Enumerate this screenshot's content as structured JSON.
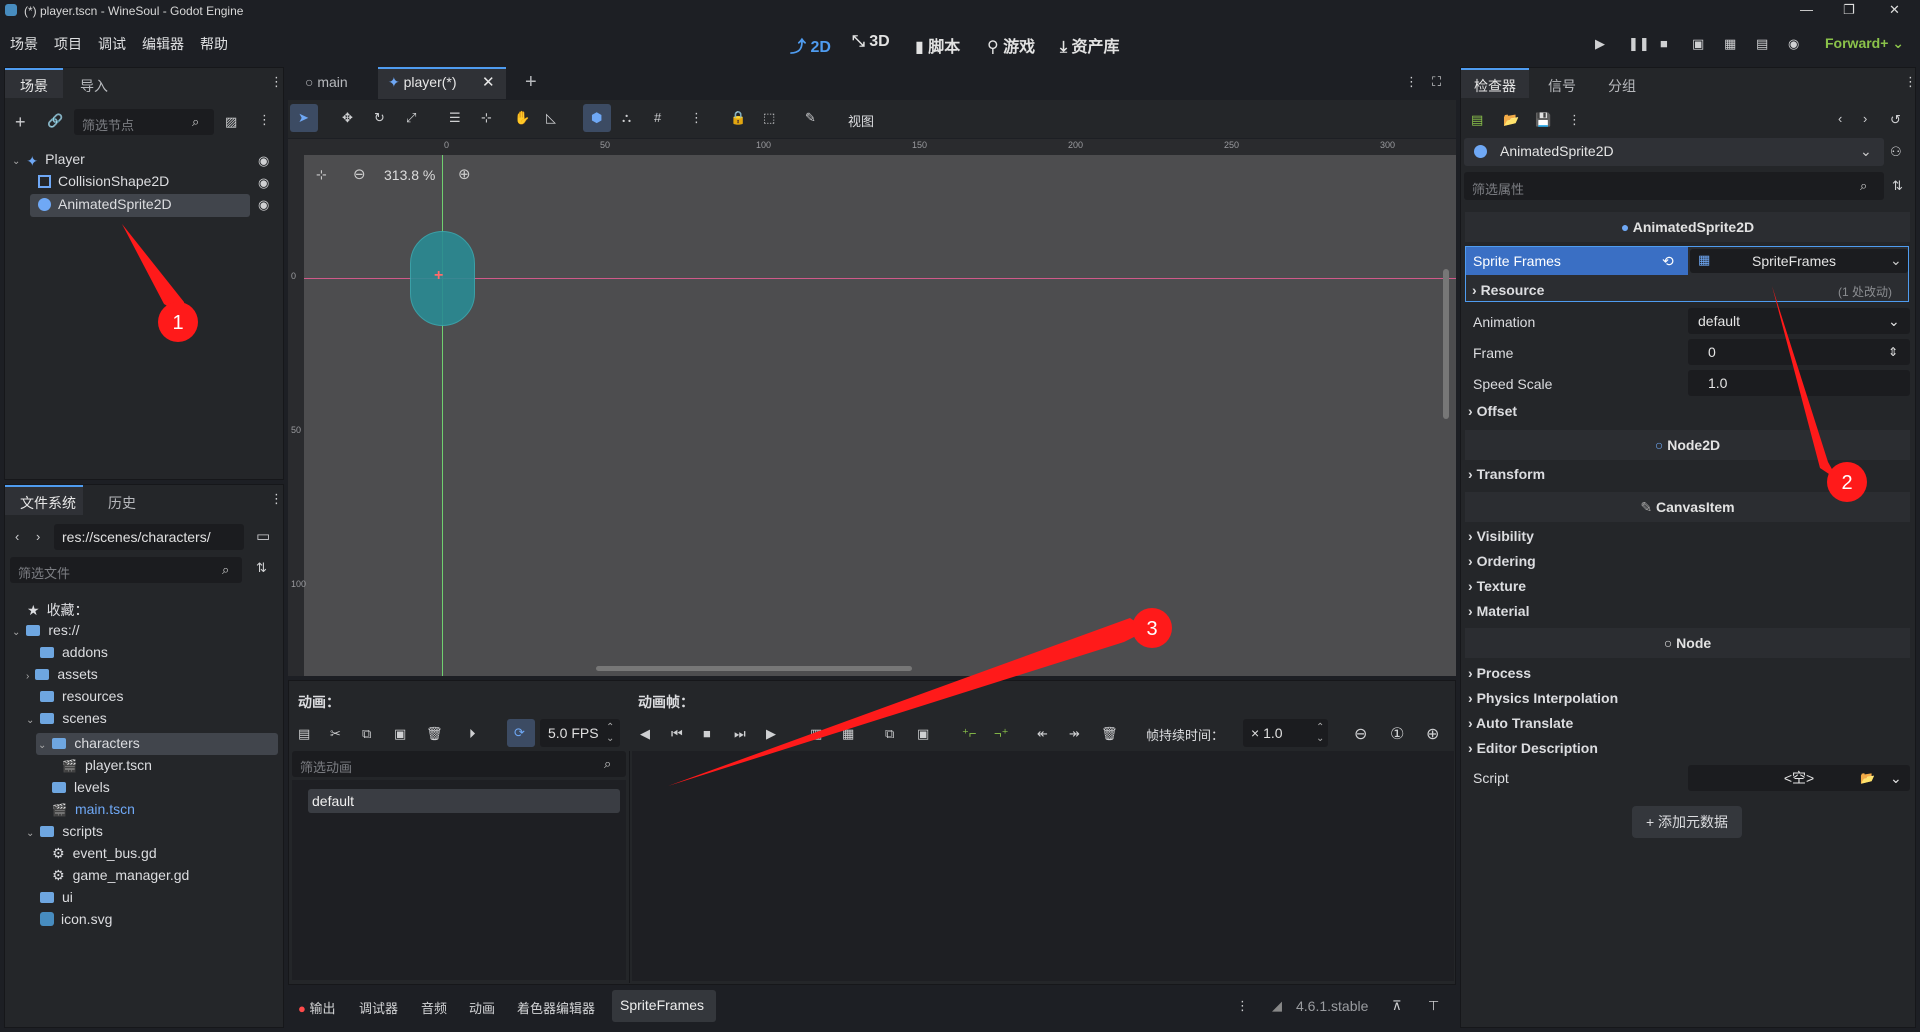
{
  "window": {
    "title": "(*) player.tscn - WineSoul - Godot Engine"
  },
  "menu": [
    "场景",
    "项目",
    "调试",
    "编辑器",
    "帮助"
  ],
  "workspaces": [
    {
      "label": "2D",
      "icon": "2d-icon"
    },
    {
      "label": "3D",
      "icon": "3d-icon"
    },
    {
      "label": "脚本",
      "icon": "script-icon"
    },
    {
      "label": "游戏",
      "icon": "game-icon"
    },
    {
      "label": "资产库",
      "icon": "assetlib-icon"
    }
  ],
  "renderer": "Forward+",
  "scene_dock": {
    "tabs": [
      "场景",
      "导入"
    ],
    "filter_placeholder": "筛选节点",
    "nodes": [
      "Player",
      "CollisionShape2D",
      "AnimatedSprite2D"
    ]
  },
  "fs_dock": {
    "tabs": [
      "文件系统",
      "历史"
    ],
    "path": "res://scenes/characters/",
    "filter_placeholder": "筛选文件",
    "favorites": "收藏：",
    "tree": [
      "res://",
      "addons",
      "assets",
      "resources",
      "scenes",
      "characters",
      "player.tscn",
      "levels",
      "main.tscn",
      "scripts",
      "event_bus.gd",
      "game_manager.gd",
      "ui",
      "icon.svg"
    ]
  },
  "editor_tabs": [
    "main",
    "player(*)"
  ],
  "toolbar": {
    "view_label": "视图"
  },
  "viewport": {
    "zoom": "313.8 %",
    "ruler_top": [
      "0",
      "50",
      "100",
      "150",
      "200",
      "250",
      "300"
    ],
    "ruler_left": [
      "0",
      "50",
      "100"
    ]
  },
  "anim_panel": {
    "anim_label": "动画：",
    "frames_label": "动画帧：",
    "fps": "5.0 FPS",
    "filter_placeholder": "筛选动画",
    "animations": [
      "default"
    ],
    "frame_duration_label": "帧持续时间：",
    "frame_duration": "× 1.0"
  },
  "bottom_tabs": [
    "输出",
    "调试器",
    "音频",
    "动画",
    "着色器编辑器",
    "SpriteFrames"
  ],
  "version": "4.6.1.stable",
  "inspector": {
    "tabs": [
      "检查器",
      "信号",
      "分组"
    ],
    "node": "AnimatedSprite2D",
    "filter_placeholder": "筛选属性",
    "class_header": "AnimatedSprite2D",
    "sprite_frames_label": "Sprite Frames",
    "sprite_frames_value": "SpriteFrames",
    "resource_label": "Resource",
    "resource_changes": "(1 处改动)",
    "animation_label": "Animation",
    "animation_value": "default",
    "frame_label": "Frame",
    "frame_value": "0",
    "speed_label": "Speed Scale",
    "speed_value": "1.0",
    "offset_label": "Offset",
    "node2d_header": "Node2D",
    "transform_label": "Transform",
    "canvas_header": "CanvasItem",
    "canvas_sections": [
      "Visibility",
      "Ordering",
      "Texture",
      "Material"
    ],
    "node_header": "Node",
    "node_sections": [
      "Process",
      "Physics Interpolation",
      "Auto Translate",
      "Editor Description"
    ],
    "script_label": "Script",
    "script_value": "<空>",
    "add_meta": "添加元数据"
  },
  "annotations": [
    "1",
    "2",
    "3"
  ],
  "colors": {
    "accent": "#4f9cf0",
    "annotation": "#ff1a1a",
    "shape": "#2a8b93"
  }
}
